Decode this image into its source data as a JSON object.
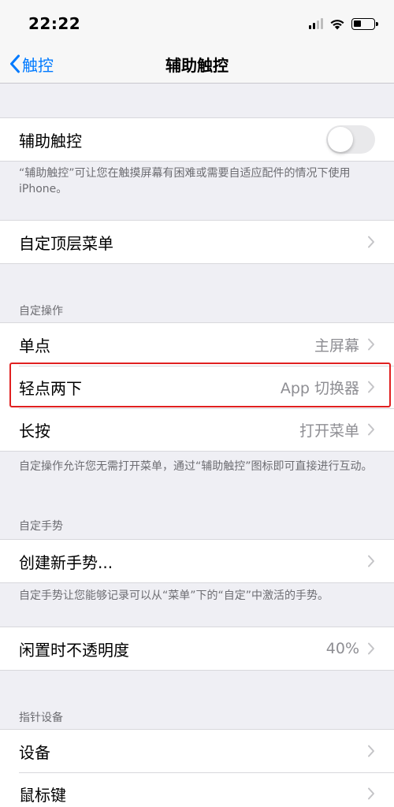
{
  "status_bar": {
    "time": "22:22"
  },
  "nav": {
    "back_label": "触控",
    "title": "辅助触控"
  },
  "assistive_touch": {
    "label": "辅助触控",
    "toggle_on": false,
    "footer": "“辅助触控”可让您在触摸屏幕有困难或需要自适应配件的情况下使用iPhone。"
  },
  "top_menu": {
    "label": "自定顶层菜单"
  },
  "custom_actions": {
    "header": "自定操作",
    "rows": [
      {
        "label": "单点",
        "value": "主屏幕"
      },
      {
        "label": "轻点两下",
        "value": "App 切换器"
      },
      {
        "label": "长按",
        "value": "打开菜单"
      }
    ],
    "footer": "自定操作允许您无需打开菜单，通过“辅助触控”图标即可直接进行互动。"
  },
  "custom_gestures": {
    "header": "自定手势",
    "create_label": "创建新手势...",
    "footer": "自定手势让您能够记录可以从“菜单”下的“自定”中激活的手势。"
  },
  "idle_opacity": {
    "label": "闲置时不透明度",
    "value": "40%"
  },
  "pointer_devices": {
    "header": "指针设备",
    "rows": [
      {
        "label": "设备"
      },
      {
        "label": "鼠标键"
      }
    ]
  },
  "colors": {
    "accent": "#007aff",
    "highlight": "#e02020",
    "background": "#efeff4"
  }
}
